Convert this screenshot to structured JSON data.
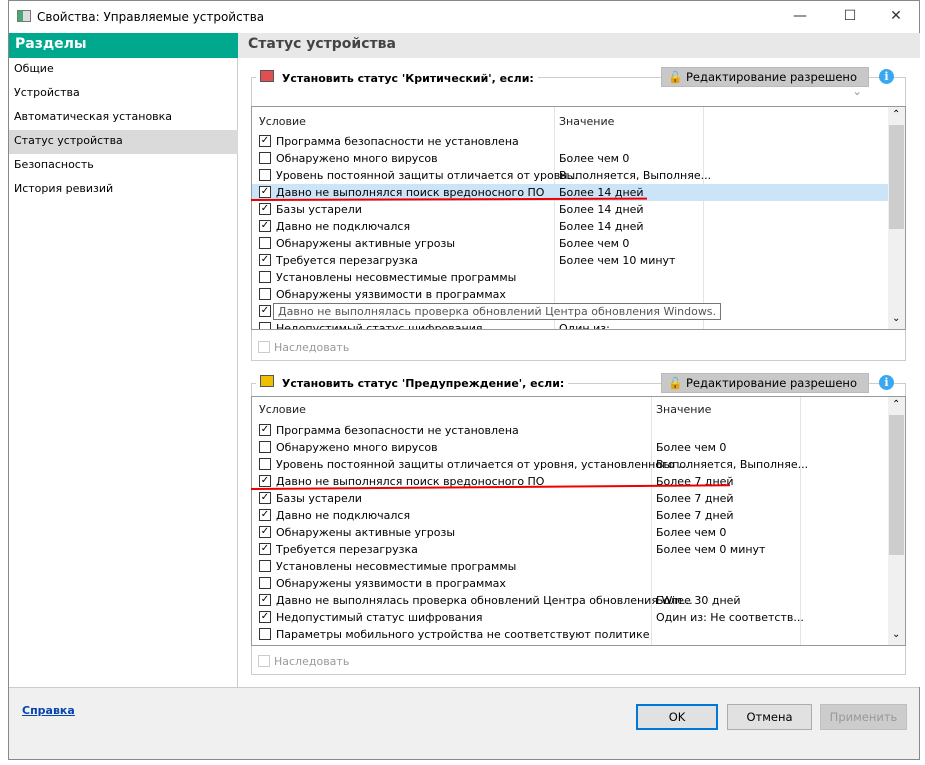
{
  "window": {
    "title": "Свойства: Управляемые устройства",
    "minimize": "—",
    "maximize": "☐",
    "close": "✕"
  },
  "sidebar": {
    "title": "Разделы",
    "items": [
      {
        "label": "Общие"
      },
      {
        "label": "Устройства"
      },
      {
        "label": "Автоматическая установка"
      },
      {
        "label": "Статус устройства"
      },
      {
        "label": "Безопасность"
      },
      {
        "label": "История ревизий"
      }
    ]
  },
  "main": {
    "title": "Статус устройства"
  },
  "critical": {
    "title": "Установить статус 'Критический', если:",
    "color": "#e05050",
    "lock_label": "Редактирование разрешено",
    "col_condition": "Условие",
    "col_value": "Значение",
    "inherit": "Наследовать",
    "rows": [
      {
        "checked": true,
        "condition": "Программа безопасности не установлена",
        "value": ""
      },
      {
        "checked": false,
        "condition": "Обнаружено много вирусов",
        "value": "Более чем 0"
      },
      {
        "checked": false,
        "condition": "Уровень постоянной защиты отличается от уровн...",
        "value": "Выполняется, Выполняе..."
      },
      {
        "checked": true,
        "condition": "Давно не выполнялся поиск вредоносного ПО",
        "value": "Более 14 дней"
      },
      {
        "checked": true,
        "condition": "Базы устарели",
        "value": "Более 14 дней"
      },
      {
        "checked": true,
        "condition": "Давно не подключался",
        "value": "Более 14 дней"
      },
      {
        "checked": false,
        "condition": "Обнаружены активные угрозы",
        "value": "Более чем 0"
      },
      {
        "checked": true,
        "condition": "Требуется перезагрузка",
        "value": "Более чем 10 минут"
      },
      {
        "checked": false,
        "condition": "Установлены несовместимые программы",
        "value": ""
      },
      {
        "checked": false,
        "condition": "Обнаружены уязвимости в программах",
        "value": ""
      },
      {
        "checked": true,
        "condition": "Давно не выполнялась проверка обновлений Центра обновления Windows.",
        "value": ""
      },
      {
        "checked": false,
        "condition": "Недопустимый статус шифрования",
        "value": "Один из:"
      }
    ]
  },
  "warning": {
    "title": "Установить статус 'Предупреждение', если:",
    "color": "#f0c000",
    "lock_label": "Редактирование разрешено",
    "col_condition": "Условие",
    "col_value": "Значение",
    "inherit": "Наследовать",
    "rows": [
      {
        "checked": true,
        "condition": "Программа безопасности не установлена",
        "value": ""
      },
      {
        "checked": false,
        "condition": "Обнаружено много вирусов",
        "value": "Более чем 0"
      },
      {
        "checked": false,
        "condition": "Уровень постоянной защиты отличается от уровня, установленного ...",
        "value": "Выполняется, Выполняе..."
      },
      {
        "checked": true,
        "condition": "Давно не выполнялся поиск вредоносного ПО",
        "value": "Более 7 дней"
      },
      {
        "checked": true,
        "condition": "Базы устарели",
        "value": "Более 7 дней"
      },
      {
        "checked": true,
        "condition": "Давно не подключался",
        "value": "Более 7 дней"
      },
      {
        "checked": true,
        "condition": "Обнаружены активные угрозы",
        "value": "Более чем 0"
      },
      {
        "checked": true,
        "condition": "Требуется перезагрузка",
        "value": "Более чем 0 минут"
      },
      {
        "checked": false,
        "condition": "Установлены несовместимые программы",
        "value": ""
      },
      {
        "checked": false,
        "condition": "Обнаружены уязвимости в программах",
        "value": ""
      },
      {
        "checked": true,
        "condition": "Давно не выполнялась проверка обновлений Центра обновления Win...",
        "value": "Более 30 дней"
      },
      {
        "checked": true,
        "condition": "Недопустимый статус шифрования",
        "value": "Один из: Не соответств..."
      },
      {
        "checked": false,
        "condition": "Параметры мобильного устройства не соответствуют политике",
        "value": ""
      }
    ]
  },
  "footer": {
    "help": "Справка",
    "ok": "OK",
    "cancel": "Отмена",
    "apply": "Применить"
  }
}
